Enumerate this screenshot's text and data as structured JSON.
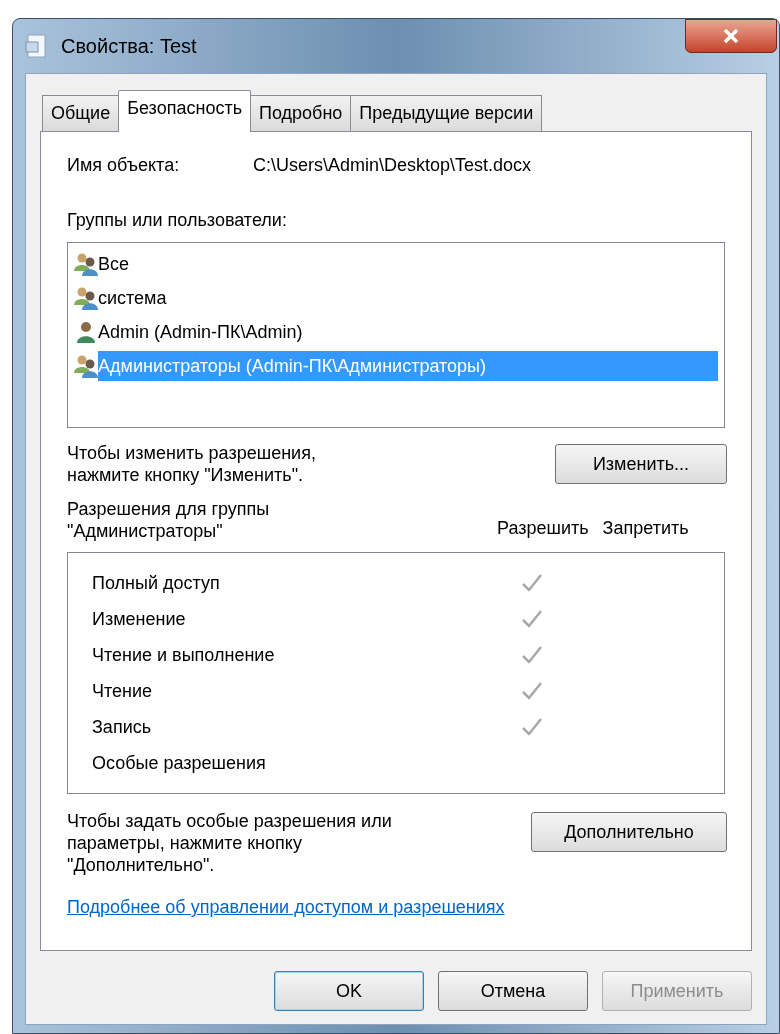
{
  "window": {
    "title": "Свойства: Test"
  },
  "tabs": [
    {
      "label": "Общие",
      "selected": false
    },
    {
      "label": "Безопасность",
      "selected": true
    },
    {
      "label": "Подробно",
      "selected": false
    },
    {
      "label": "Предыдущие версии",
      "selected": false
    }
  ],
  "object_name": {
    "label": "Имя объекта:",
    "value": "C:\\Users\\Admin\\Desktop\\Test.docx"
  },
  "groups": {
    "label": "Группы или пользователи:",
    "items": [
      {
        "name": "Все",
        "kind": "group",
        "selected": false
      },
      {
        "name": "система",
        "kind": "group",
        "selected": false
      },
      {
        "name": "Admin (Admin-ПК\\Admin)",
        "kind": "user",
        "selected": false
      },
      {
        "name": "Администраторы (Admin-ПК\\Администраторы)",
        "kind": "group",
        "selected": true
      }
    ]
  },
  "change_hint": "Чтобы изменить разрешения, нажмите кнопку \"Изменить\".",
  "change_button": "Изменить...",
  "permissions": {
    "label": "Разрешения для группы \"Администраторы\"",
    "allow_header": "Разрешить",
    "deny_header": "Запретить",
    "rows": [
      {
        "name": "Полный доступ",
        "allow": true,
        "deny": false
      },
      {
        "name": "Изменение",
        "allow": true,
        "deny": false
      },
      {
        "name": "Чтение и выполнение",
        "allow": true,
        "deny": false
      },
      {
        "name": "Чтение",
        "allow": true,
        "deny": false
      },
      {
        "name": "Запись",
        "allow": true,
        "deny": false
      },
      {
        "name": "Особые разрешения",
        "allow": false,
        "deny": false
      }
    ]
  },
  "advanced_hint": "Чтобы задать особые разрешения или параметры, нажмите кнопку \"Дополнительно\".",
  "advanced_button": "Дополнительно",
  "link": "Подробнее об управлении доступом и разрешениях",
  "buttons": [
    {
      "label": "OK",
      "kind": "default",
      "disabled": false
    },
    {
      "label": "Отмена",
      "kind": "normal",
      "disabled": false
    },
    {
      "label": "Применить",
      "kind": "normal",
      "disabled": true
    }
  ]
}
